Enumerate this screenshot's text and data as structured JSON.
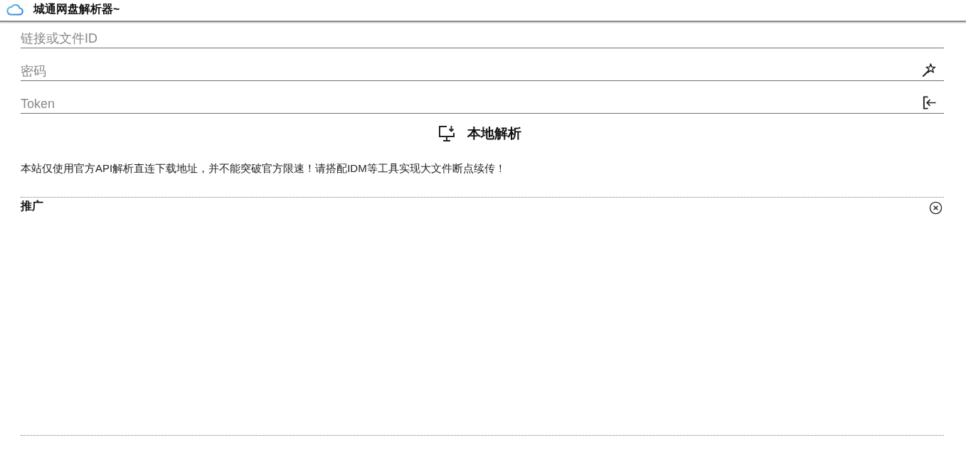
{
  "header": {
    "title": "城通网盘解析器~"
  },
  "fields": [
    {
      "kind": "plain",
      "placeholder": "链接或文件ID"
    },
    {
      "kind": "password",
      "placeholder": "密码"
    },
    {
      "kind": "token",
      "placeholder": "Token"
    }
  ],
  "parse_button": {
    "label": "本地解析"
  },
  "notice": "本站仅使用官方API解析直连下载地址，并不能突破官方限速！请搭配IDM等工具实现大文件断点续传！",
  "promo": {
    "title": "推广"
  }
}
